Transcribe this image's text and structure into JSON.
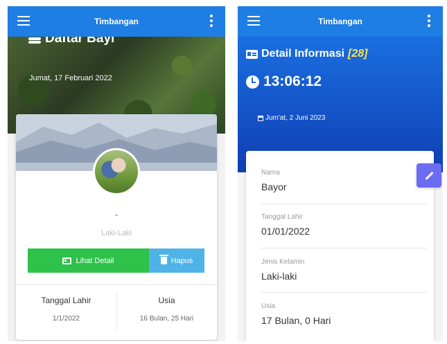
{
  "left_screen": {
    "appbar": {
      "title": "Timbangan"
    },
    "hero": {
      "title": "Daftar Bayi",
      "date": "Jumat, 17 Februari 2022"
    },
    "card": {
      "name": "-",
      "gender": "Laki-Laki",
      "detail_button": "Lihat Detail",
      "delete_button": "Hapus",
      "stats": [
        {
          "label": "Tanggal Lahir",
          "value": "1/1/2022"
        },
        {
          "label": "Usia",
          "value": "16 Bulan, 25 Hari"
        }
      ]
    }
  },
  "right_screen": {
    "appbar": {
      "title": "Timbangan"
    },
    "hero": {
      "title": "Detail Informasi",
      "count": "[28]",
      "time": "13:06:12",
      "date": "Jum'at, 2 Juni 2023"
    },
    "fields": [
      {
        "label": "Nama",
        "value": "Bayor"
      },
      {
        "label": "Tanggal Lahir",
        "value": "01/01/2022"
      },
      {
        "label": "Jenis Kelamin",
        "value": "Laki-laki"
      },
      {
        "label": "Usia",
        "value": "17 Bulan, 0 Hari"
      }
    ]
  },
  "icons": [
    "menu-icon",
    "more-vert-icon",
    "layers-icon",
    "id-card-icon",
    "trash-icon",
    "clock-icon",
    "calendar-icon",
    "pencil-icon"
  ],
  "colors": {
    "appbar": "#1e7ee3",
    "detail_button": "#2ec24a",
    "delete_button": "#4fb3e8",
    "accent_count": "#ffe04a",
    "edit_fab": "#6c6cf2"
  }
}
